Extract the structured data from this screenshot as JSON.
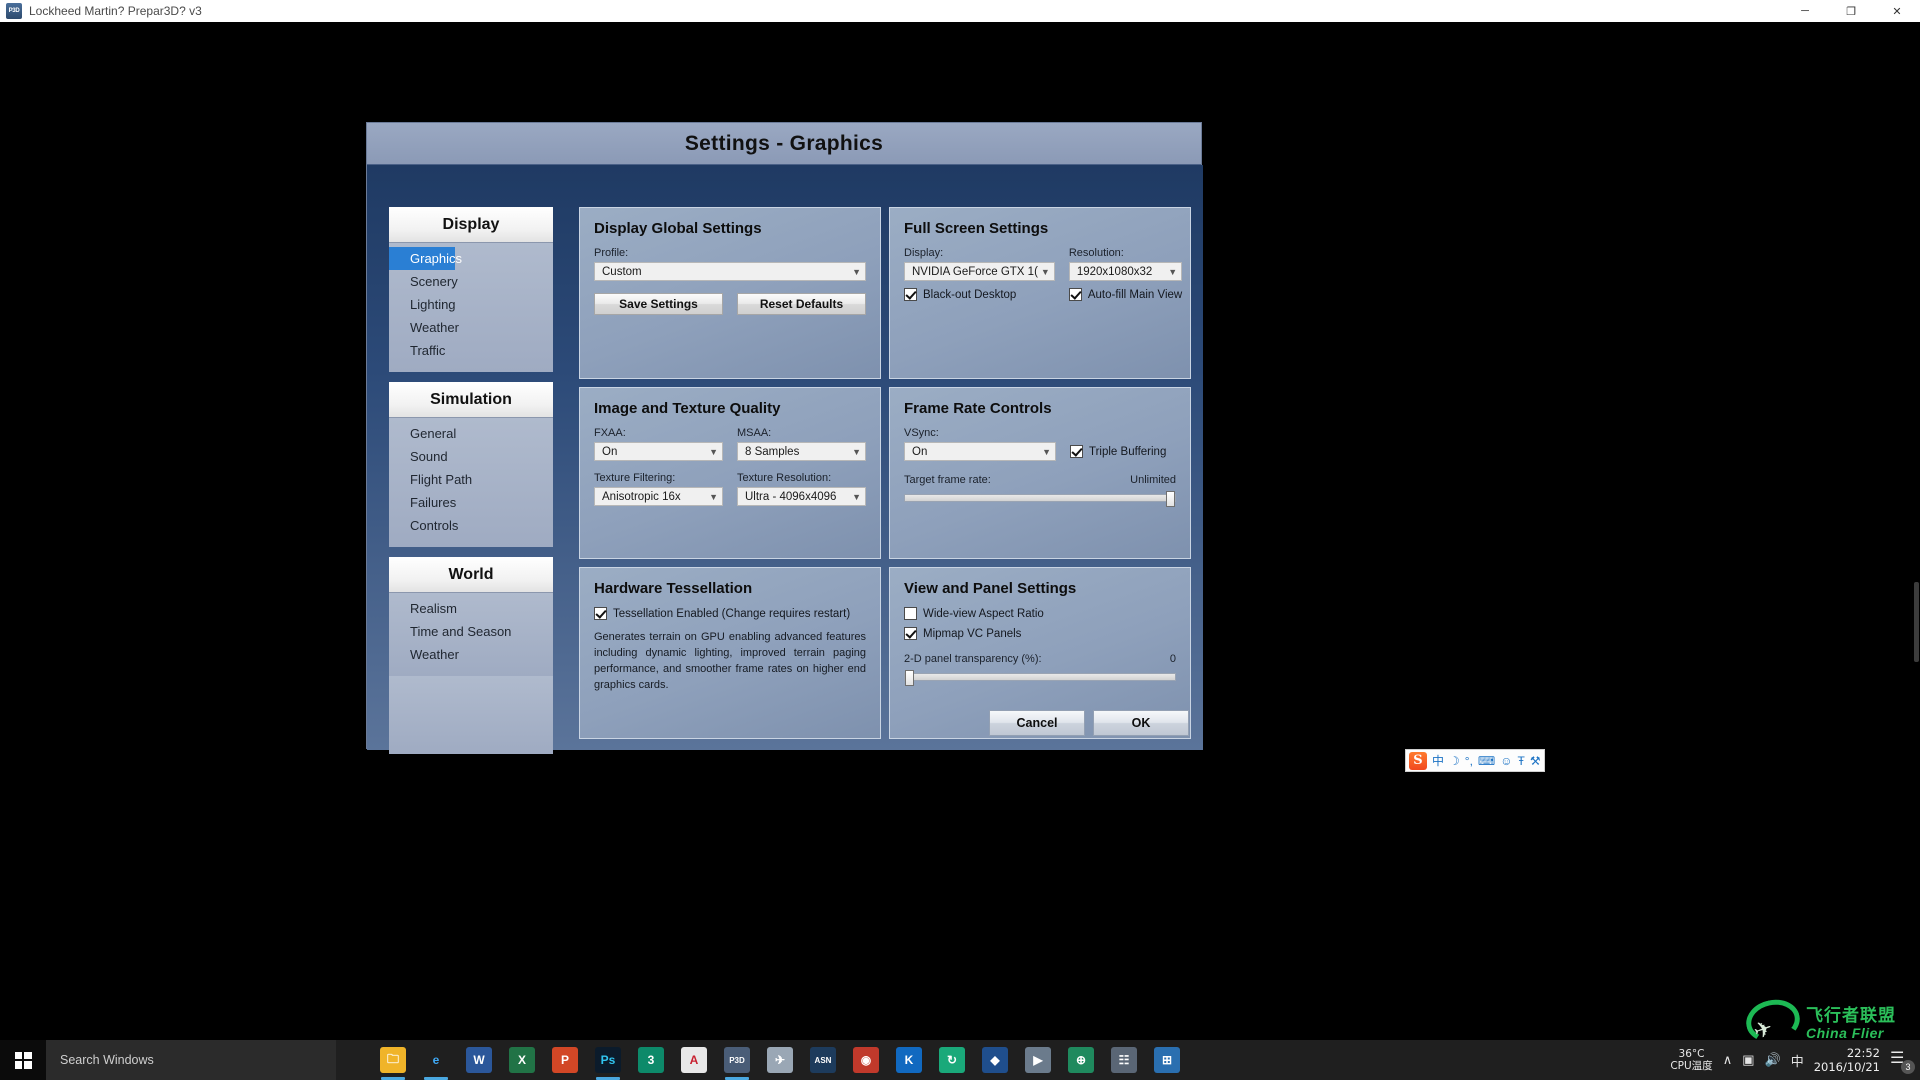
{
  "window": {
    "title": "Lockheed Martin? Prepar3D? v3",
    "icon": "p3d-app-icon",
    "minimize": "─",
    "maximize": "❐",
    "close": "✕"
  },
  "dialog": {
    "title": "Settings - Graphics",
    "footer": {
      "cancel": "Cancel",
      "ok": "OK"
    }
  },
  "sidebar": {
    "groups": [
      {
        "header": "Display",
        "items": [
          {
            "label": "Graphics",
            "active": true
          },
          {
            "label": "Scenery",
            "active": false
          },
          {
            "label": "Lighting",
            "active": false
          },
          {
            "label": "Weather",
            "active": false
          },
          {
            "label": "Traffic",
            "active": false
          }
        ]
      },
      {
        "header": "Simulation",
        "items": [
          {
            "label": "General",
            "active": false
          },
          {
            "label": "Sound",
            "active": false
          },
          {
            "label": "Flight Path",
            "active": false
          },
          {
            "label": "Failures",
            "active": false
          },
          {
            "label": "Controls",
            "active": false
          }
        ]
      },
      {
        "header": "World",
        "items": [
          {
            "label": "Realism",
            "active": false
          },
          {
            "label": "Time and Season",
            "active": false
          },
          {
            "label": "Weather",
            "active": false
          }
        ]
      }
    ]
  },
  "panels": {
    "display_global": {
      "title": "Display Global Settings",
      "profile_label": "Profile:",
      "profile_value": "Custom",
      "save_label": "Save Settings",
      "reset_label": "Reset Defaults"
    },
    "full_screen": {
      "title": "Full Screen Settings",
      "display_label": "Display:",
      "display_value": "NVIDIA GeForce GTX 1(",
      "resolution_label": "Resolution:",
      "resolution_value": "1920x1080x32",
      "blackout_label": "Black-out Desktop",
      "blackout_checked": true,
      "autofill_label": "Auto-fill Main View",
      "autofill_checked": true
    },
    "image_texture": {
      "title": "Image and Texture Quality",
      "fxaa_label": "FXAA:",
      "fxaa_value": "On",
      "msaa_label": "MSAA:",
      "msaa_value": "8 Samples",
      "filtering_label": "Texture Filtering:",
      "filtering_value": "Anisotropic 16x",
      "texres_label": "Texture Resolution:",
      "texres_value": "Ultra - 4096x4096"
    },
    "frame_rate": {
      "title": "Frame Rate Controls",
      "vsync_label": "VSync:",
      "vsync_value": "On",
      "triple_label": "Triple Buffering",
      "triple_checked": true,
      "target_label": "Target frame rate:",
      "target_value": "Unlimited",
      "target_percent": 100
    },
    "tessellation": {
      "title": "Hardware Tessellation",
      "enabled_label": "Tessellation Enabled (Change requires restart)",
      "enabled_checked": true,
      "description": "Generates terrain on GPU enabling advanced features including dynamic lighting, improved terrain paging performance, and smoother frame rates on higher end graphics cards."
    },
    "view_panel": {
      "title": "View and Panel Settings",
      "wideview_label": "Wide-view Aspect Ratio",
      "wideview_checked": false,
      "mipmap_label": "Mipmap VC Panels",
      "mipmap_checked": true,
      "transparency_label": "2-D panel transparency (%):",
      "transparency_value": "0",
      "transparency_percent": 0
    }
  },
  "ime": {
    "logo": "S",
    "items": [
      "中",
      "☽",
      "°,",
      "⌨",
      "☺",
      "Ŧ",
      "⚒"
    ]
  },
  "watermark": {
    "cn": "飞行者联盟",
    "en": "China Flier"
  },
  "taskbar": {
    "start_icon": "windows-logo",
    "search_placeholder": "Search Windows",
    "apps": [
      {
        "name": "file-explorer",
        "glyph": "🗀",
        "bg": "#f0b429",
        "color": "#ffffff",
        "open": true
      },
      {
        "name": "edge-browser",
        "glyph": "e",
        "bg": "transparent",
        "color": "#3fa9f5",
        "open": true
      },
      {
        "name": "word",
        "glyph": "W",
        "bg": "#2b579a",
        "color": "#ffffff",
        "open": false
      },
      {
        "name": "excel",
        "glyph": "X",
        "bg": "#217346",
        "color": "#ffffff",
        "open": false
      },
      {
        "name": "powerpoint",
        "glyph": "P",
        "bg": "#d24726",
        "color": "#ffffff",
        "open": false
      },
      {
        "name": "photoshop",
        "glyph": "Ps",
        "bg": "#0b1b2b",
        "color": "#31c5f0",
        "open": true
      },
      {
        "name": "3ds-max",
        "glyph": "3",
        "bg": "#0d8a6a",
        "color": "#ffffff",
        "open": false
      },
      {
        "name": "autocad",
        "glyph": "A",
        "bg": "#e8e8e8",
        "color": "#c8202f",
        "open": false
      },
      {
        "name": "prepar3d",
        "glyph": "P3D",
        "bg": "#4a5d77",
        "color": "#ffffff",
        "open": true
      },
      {
        "name": "asn-weather",
        "glyph": "✈",
        "bg": "#9aa7b5",
        "color": "#ffffff",
        "open": false
      },
      {
        "name": "active-sky",
        "glyph": "ASN",
        "bg": "#1d3b5c",
        "color": "#ffffff",
        "open": false
      },
      {
        "name": "ezdok",
        "glyph": "◉",
        "bg": "#c0392b",
        "color": "#ffffff",
        "open": false
      },
      {
        "name": "kingsoft",
        "glyph": "K",
        "bg": "#1169c0",
        "color": "#ffffff",
        "open": false
      },
      {
        "name": "sync-app",
        "glyph": "↻",
        "bg": "#1aa97a",
        "color": "#ffffff",
        "open": false
      },
      {
        "name": "navigraph",
        "glyph": "◆",
        "bg": "#1f4e8c",
        "color": "#ffffff",
        "open": false
      },
      {
        "name": "media-player",
        "glyph": "▶",
        "bg": "#6b7b8c",
        "color": "#ffffff",
        "open": false
      },
      {
        "name": "globe-app",
        "glyph": "⊕",
        "bg": "#1f8a5e",
        "color": "#ffffff",
        "open": false
      },
      {
        "name": "monitor-app",
        "glyph": "☷",
        "bg": "#5a6675",
        "color": "#ffffff",
        "open": false
      },
      {
        "name": "calculator-app",
        "glyph": "⊞",
        "bg": "#2a6fb0",
        "color": "#ffffff",
        "open": false
      }
    ],
    "tray": {
      "cpu_temp": "36°C",
      "cpu_temp_label": "CPU温度",
      "chevron": "∧",
      "network": "▣",
      "volume": "🔊",
      "ime_mode": "中",
      "time": "22:52",
      "date": "2016/10/21",
      "notification_count": "3"
    }
  }
}
